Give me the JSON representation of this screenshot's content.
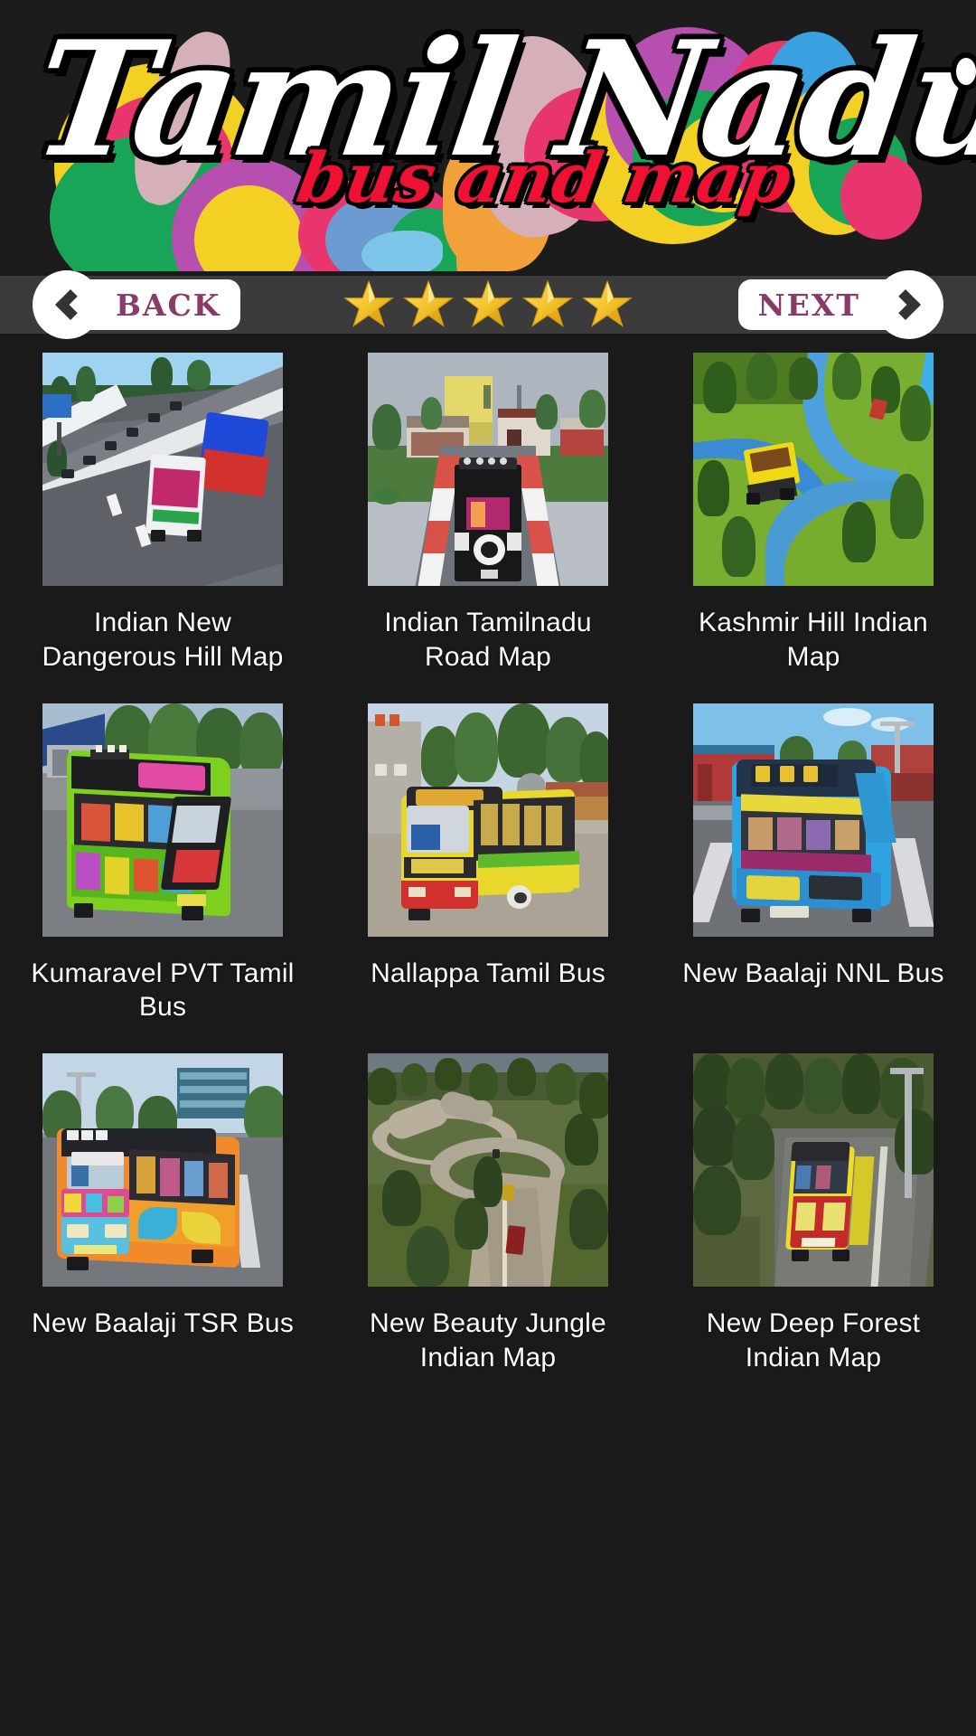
{
  "app": {
    "banner": {
      "title_main": "Tamil Nadu",
      "title_sub": "bus and map"
    },
    "navbar": {
      "back_label": "BACK",
      "next_label": "NEXT",
      "back_icon": "chevron-left-icon",
      "next_icon": "chevron-right-icon",
      "rating_stars": 5,
      "star_color": "#f2c029",
      "pill_text_color": "#8a3a68",
      "bar_color": "#3b3b3b"
    },
    "theme": {
      "background": "#1a1a1a",
      "banner_background": "#1c1c1c",
      "caption_color": "#ffffff",
      "accent_red": "#ee1133"
    },
    "grid": {
      "columns": 3,
      "items": [
        {
          "id": "indian-new-dangerous-hill-map",
          "label": "Indian New Dangerous Hill Map",
          "thumb": "hill-road-bus-truck"
        },
        {
          "id": "indian-tamilnadu-road-map",
          "label": "Indian Tamilnadu Road Map",
          "thumb": "village-road-rear-bus"
        },
        {
          "id": "kashmir-hill-indian-map",
          "label": "Kashmir Hill Indian Map",
          "thumb": "green-hill-yellow-truck"
        },
        {
          "id": "kumaravel-pvt-tamil-bus",
          "label": "Kumaravel PVT Tamil Bus",
          "thumb": "green-painted-bus"
        },
        {
          "id": "nallappa-tamil-bus",
          "label": "Nallappa Tamil Bus",
          "thumb": "yellow-red-bus"
        },
        {
          "id": "new-baalaji-nnl-bus",
          "label": "New Baalaji NNL Bus",
          "thumb": "blue-nnl-bus"
        },
        {
          "id": "new-baalaji-tsr-bus",
          "label": "New Baalaji TSR Bus",
          "thumb": "orange-tsr-bus"
        },
        {
          "id": "new-beauty-jungle-indian-map",
          "label": "New Beauty Jungle Indian Map",
          "thumb": "winding-forest-road"
        },
        {
          "id": "new-deep-forest-indian-map",
          "label": "New Deep Forest Indian Map",
          "thumb": "forest-road-yellow-bus"
        }
      ]
    }
  }
}
